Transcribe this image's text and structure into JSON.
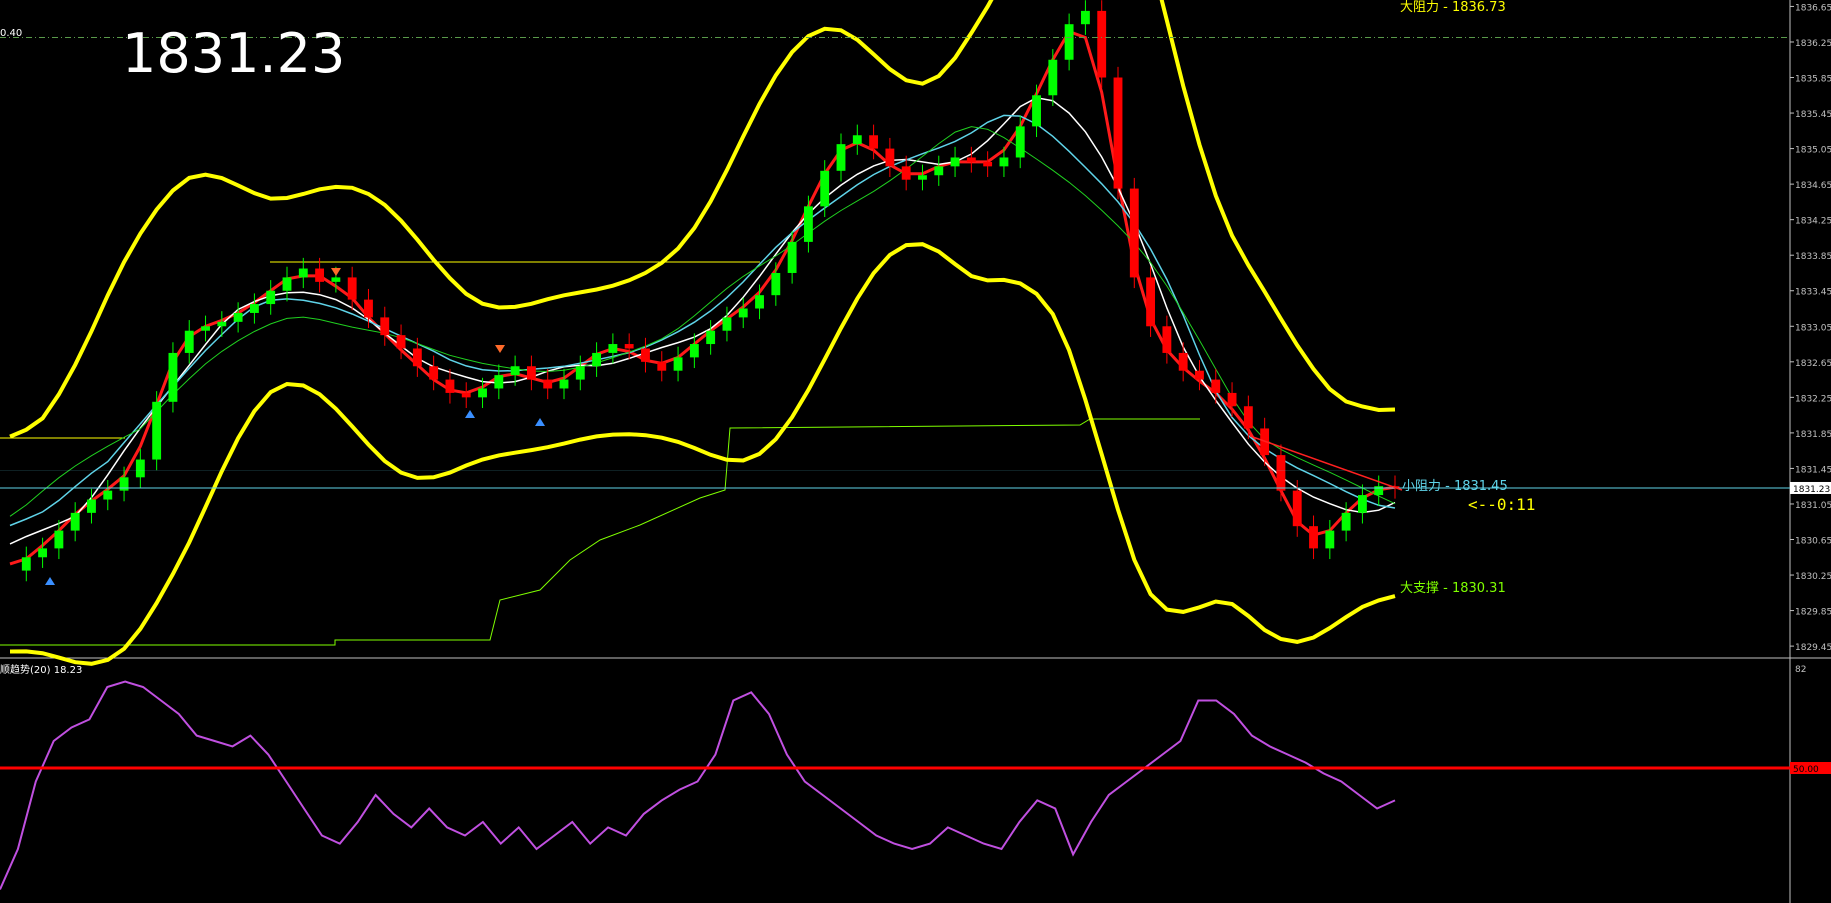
{
  "header": {
    "current_price_display": "1831.23",
    "top_left_value": "0.40"
  },
  "annotations": {
    "big_resistance": "大阻力 - 1836.73",
    "small_resistance": "小阻力 - 1831.45",
    "big_support": "大支撑 - 1830.31",
    "timer": "<--0:11"
  },
  "indicator": {
    "label": "顺趋势(20) 18.23",
    "top_value": "82",
    "level_label": "50.00",
    "level_value": 50
  },
  "colors": {
    "background": "#000000",
    "bull_candle": "#00ff00",
    "bear_candle": "#ff0000",
    "bollinger": "#ffff00",
    "resistance_line": "#ffff00",
    "support_line": "#7fff00",
    "current_price_line": "#5fd3e8",
    "indicator_line": "#c050e0",
    "indicator_level": "#ff0000"
  },
  "chart_data": {
    "type": "line",
    "title": "",
    "price_axis": {
      "ticks": [
        "1836.65",
        "1836.25",
        "1835.85",
        "1835.45",
        "1835.05",
        "1834.65",
        "1834.25",
        "1833.85",
        "1833.45",
        "1833.05",
        "1832.65",
        "1832.25",
        "1831.85",
        "1831.45",
        "1831.05",
        "1830.65",
        "1830.25",
        "1829.85",
        "1829.45"
      ],
      "ylim": [
        1829.35,
        1836.7
      ],
      "current_price_label": "1831.23"
    },
    "levels": {
      "big_resistance": 1836.73,
      "small_resistance": 1831.45,
      "big_support": 1830.31,
      "current_price": 1831.23
    },
    "series": [
      {
        "name": "",
        "role": "price",
        "values": [
          1830.3,
          1830.45,
          1830.55,
          1830.75,
          1830.95,
          1831.1,
          1831.2,
          1831.35,
          1831.55,
          1832.2,
          1832.75,
          1833.0,
          1833.05,
          1833.1,
          1833.2,
          1833.3,
          1833.45,
          1833.6,
          1833.7,
          1833.55,
          1833.6,
          1833.35,
          1833.15,
          1832.95,
          1832.8,
          1832.6,
          1832.45,
          1832.3,
          1832.25,
          1832.35,
          1832.5,
          1832.6,
          1832.45,
          1832.35,
          1832.45,
          1832.6,
          1832.75,
          1832.85,
          1832.8,
          1832.65,
          1832.55,
          1832.7,
          1832.85,
          1833.0,
          1833.15,
          1833.25,
          1833.4,
          1833.65,
          1834.0,
          1834.4,
          1834.8,
          1835.1,
          1835.2,
          1835.05,
          1834.85,
          1834.7,
          1834.75,
          1834.85,
          1834.95,
          1834.9,
          1834.85,
          1834.95,
          1835.3,
          1835.65,
          1836.05,
          1836.45,
          1836.6,
          1835.85,
          1834.6,
          1833.6,
          1833.05,
          1832.75,
          1832.55,
          1832.45,
          1832.3,
          1832.15,
          1831.9,
          1831.6,
          1831.2,
          1830.8,
          1830.55,
          1830.75,
          1830.95,
          1831.15,
          1831.25,
          1831.23
        ]
      },
      {
        "name": "",
        "role": "indicator",
        "values": [
          5,
          20,
          45,
          60,
          65,
          68,
          80,
          82,
          80,
          75,
          70,
          62,
          60,
          58,
          62,
          55,
          45,
          35,
          25,
          22,
          30,
          40,
          33,
          28,
          35,
          28,
          25,
          30,
          22,
          28,
          20,
          25,
          30,
          22,
          28,
          25,
          33,
          38,
          42,
          45,
          55,
          75,
          78,
          70,
          55,
          45,
          40,
          35,
          30,
          25,
          22,
          20,
          22,
          28,
          25,
          22,
          20,
          30,
          38,
          35,
          18,
          30,
          40,
          45,
          50,
          55,
          60,
          75,
          75,
          70,
          62,
          58,
          55,
          52,
          48,
          45,
          40,
          35,
          38
        ]
      }
    ]
  }
}
